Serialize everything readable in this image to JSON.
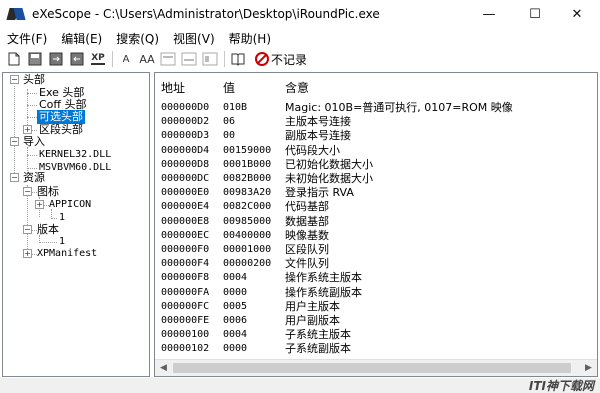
{
  "window": {
    "title": "eXeScope - C:\\Users\\Administrator\\Desktop\\iRoundPic.exe",
    "minimize": "—",
    "maximize": "☐",
    "close": "✕"
  },
  "menu": [
    "文件(F)",
    "编辑(E)",
    "搜索(Q)",
    "视图(V)",
    "帮助(H)"
  ],
  "toolbar": {
    "buttons": [
      "open-icon",
      "save-icon",
      "export-icon",
      "import-icon",
      "xp-icon",
      "font-icon",
      "font-size-icon",
      "dialog-icon",
      "dialog2-icon",
      "dialog3-icon"
    ],
    "xp_label": "XP",
    "font_label": "A",
    "font2_label": "AA",
    "no_record_label": "不记录"
  },
  "tree": {
    "header": "头部",
    "exe_header": "Exe 头部",
    "coff_header": "Coff 头部",
    "optional_header": "可选头部",
    "section_header": "区段头部",
    "imports": "导入",
    "kernel32": "KERNEL32.DLL",
    "msvbvm60": "MSVBVM60.DLL",
    "resources": "资源",
    "icons": "图标",
    "appicon": "APPICON",
    "appicon_1": "1",
    "version": "版本",
    "version_1": "1",
    "xpmanifest": "XPManifest"
  },
  "list": {
    "columns": [
      "地址",
      "值",
      "含意"
    ],
    "rows": [
      {
        "addr": "000000D0",
        "val": "010B",
        "mean": "Magic: 010B=普通可执行, 0107=ROM 映像"
      },
      {
        "addr": "000000D2",
        "val": "06",
        "mean": "主版本号连接"
      },
      {
        "addr": "000000D3",
        "val": "00",
        "mean": "副版本号连接"
      },
      {
        "addr": "000000D4",
        "val": "00159000",
        "mean": "代码段大小"
      },
      {
        "addr": "000000D8",
        "val": "0001B000",
        "mean": "已初始化数据大小"
      },
      {
        "addr": "000000DC",
        "val": "0082B000",
        "mean": "未初始化数据大小"
      },
      {
        "addr": "000000E0",
        "val": "00983A20",
        "mean": "登录指示 RVA"
      },
      {
        "addr": "000000E4",
        "val": "0082C000",
        "mean": "代码基部"
      },
      {
        "addr": "000000E8",
        "val": "00985000",
        "mean": "数据基部"
      },
      {
        "addr": "000000EC",
        "val": "00400000",
        "mean": "映像基数"
      },
      {
        "addr": "000000F0",
        "val": "00001000",
        "mean": "区段队列"
      },
      {
        "addr": "000000F4",
        "val": "00000200",
        "mean": "文件队列"
      },
      {
        "addr": "000000F8",
        "val": "0004",
        "mean": "操作系统主版本"
      },
      {
        "addr": "000000FA",
        "val": "0000",
        "mean": "操作系统副版本"
      },
      {
        "addr": "000000FC",
        "val": "0005",
        "mean": "用户主版本"
      },
      {
        "addr": "000000FE",
        "val": "0006",
        "mean": "用户副版本"
      },
      {
        "addr": "00000100",
        "val": "0004",
        "mean": "子系统主版本"
      },
      {
        "addr": "00000102",
        "val": "0000",
        "mean": "子系统副版本"
      }
    ]
  },
  "scrollbar": {
    "left": "◀",
    "right": "▶"
  },
  "watermark": "ITI神下载网"
}
